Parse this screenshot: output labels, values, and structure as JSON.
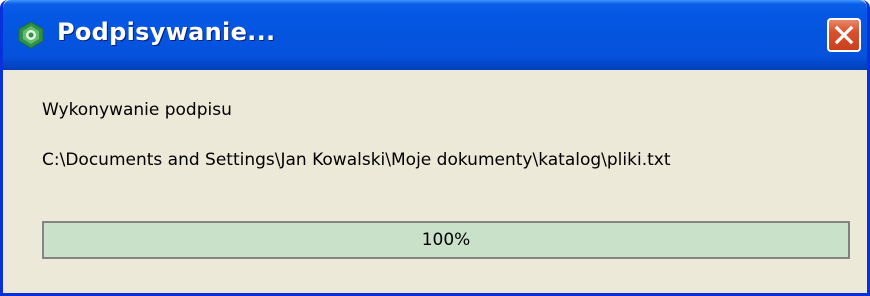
{
  "window": {
    "title": "Podpisywanie...",
    "close_icon": "close-icon",
    "app_icon": "app-shield-icon"
  },
  "content": {
    "status_label": "Wykonywanie podpisu",
    "file_path": "C:\\Documents and Settings\\Jan Kowalski\\Moje dokumenty\\katalog\\pliki.txt"
  },
  "progress": {
    "value": 100,
    "label": "100%"
  },
  "colors": {
    "titlebar": "#0554df",
    "window_bg": "#ece9d8",
    "close_button": "#d9512c",
    "progress_fill": "#c9e0c9"
  }
}
